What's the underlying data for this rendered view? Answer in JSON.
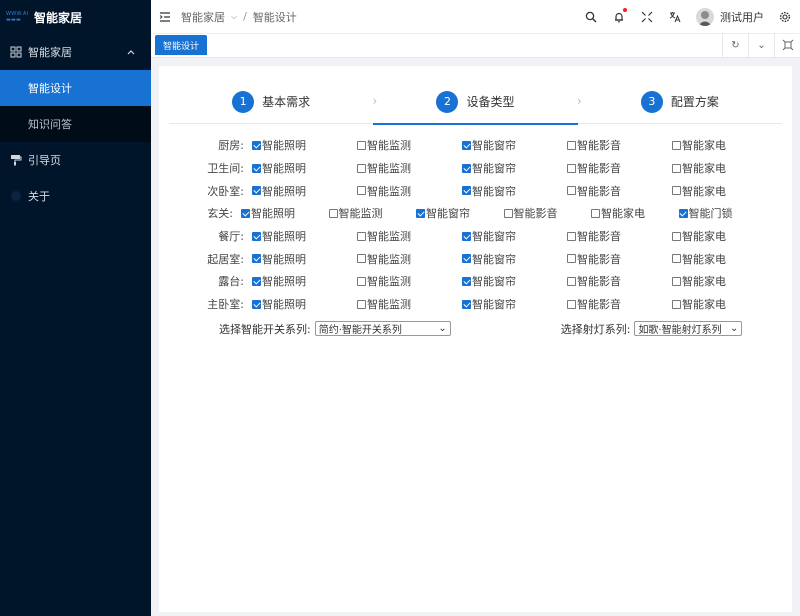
{
  "sidebar": {
    "logo_text": "WWW.AI",
    "brand_title": "智能家居",
    "group_label": "智能家居",
    "sub_items": [
      {
        "label": "智能设计",
        "active": true
      },
      {
        "label": "知识问答",
        "active": false
      }
    ],
    "items": [
      {
        "label": "引导页"
      },
      {
        "label": "关于"
      }
    ]
  },
  "header": {
    "breadcrumb": [
      "智能家居",
      "智能设计"
    ],
    "user_name": "测试用户"
  },
  "tabs": [
    {
      "label": "智能设计"
    }
  ],
  "steps": [
    {
      "num": "1",
      "label": "基本需求",
      "active": false
    },
    {
      "num": "2",
      "label": "设备类型",
      "active": true
    },
    {
      "num": "3",
      "label": "配置方案",
      "active": false
    }
  ],
  "rooms": [
    {
      "name": "厨房:",
      "options": [
        {
          "label": "智能照明",
          "checked": true
        },
        {
          "label": "智能监测",
          "checked": false
        },
        {
          "label": "智能窗帘",
          "checked": true
        },
        {
          "label": "智能影音",
          "checked": false
        },
        {
          "label": "智能家电",
          "checked": false
        }
      ]
    },
    {
      "name": "卫生间:",
      "options": [
        {
          "label": "智能照明",
          "checked": true
        },
        {
          "label": "智能监测",
          "checked": false
        },
        {
          "label": "智能窗帘",
          "checked": true
        },
        {
          "label": "智能影音",
          "checked": false
        },
        {
          "label": "智能家电",
          "checked": false
        }
      ]
    },
    {
      "name": "次卧室:",
      "options": [
        {
          "label": "智能照明",
          "checked": true
        },
        {
          "label": "智能监测",
          "checked": false
        },
        {
          "label": "智能窗帘",
          "checked": true
        },
        {
          "label": "智能影音",
          "checked": false
        },
        {
          "label": "智能家电",
          "checked": false
        }
      ]
    },
    {
      "name": "玄关:",
      "wide": true,
      "options": [
        {
          "label": "智能照明",
          "checked": true
        },
        {
          "label": "智能监测",
          "checked": false
        },
        {
          "label": "智能窗帘",
          "checked": true
        },
        {
          "label": "智能影音",
          "checked": false
        },
        {
          "label": "智能家电",
          "checked": false
        },
        {
          "label": "智能门锁",
          "checked": true
        }
      ]
    },
    {
      "name": "餐厅:",
      "options": [
        {
          "label": "智能照明",
          "checked": true
        },
        {
          "label": "智能监测",
          "checked": false
        },
        {
          "label": "智能窗帘",
          "checked": true
        },
        {
          "label": "智能影音",
          "checked": false
        },
        {
          "label": "智能家电",
          "checked": false
        }
      ]
    },
    {
      "name": "起居室:",
      "options": [
        {
          "label": "智能照明",
          "checked": true
        },
        {
          "label": "智能监测",
          "checked": false
        },
        {
          "label": "智能窗帘",
          "checked": true
        },
        {
          "label": "智能影音",
          "checked": false
        },
        {
          "label": "智能家电",
          "checked": false
        }
      ]
    },
    {
      "name": "露台:",
      "options": [
        {
          "label": "智能照明",
          "checked": true
        },
        {
          "label": "智能监测",
          "checked": false
        },
        {
          "label": "智能窗帘",
          "checked": true
        },
        {
          "label": "智能影音",
          "checked": false
        },
        {
          "label": "智能家电",
          "checked": false
        }
      ]
    },
    {
      "name": "主卧室:",
      "options": [
        {
          "label": "智能照明",
          "checked": true
        },
        {
          "label": "智能监测",
          "checked": false
        },
        {
          "label": "智能窗帘",
          "checked": true
        },
        {
          "label": "智能影音",
          "checked": false
        },
        {
          "label": "智能家电",
          "checked": false
        }
      ]
    }
  ],
  "selects": {
    "switch_label": "选择智能开关系列:",
    "switch_value": "简约·智能开关系列",
    "light_label": "选择射灯系列:",
    "light_value": "如歌·智能射灯系列"
  },
  "colors": {
    "primary": "#1772d4",
    "sidebar_bg": "#001529",
    "notify_dot": "#f5222d"
  },
  "icons": {
    "menu_toggle": "menu-fold-icon",
    "search": "search-icon",
    "bell": "bell-icon",
    "fullscreen": "fullscreen-icon",
    "translate": "translate-icon",
    "settings": "gear-icon"
  }
}
